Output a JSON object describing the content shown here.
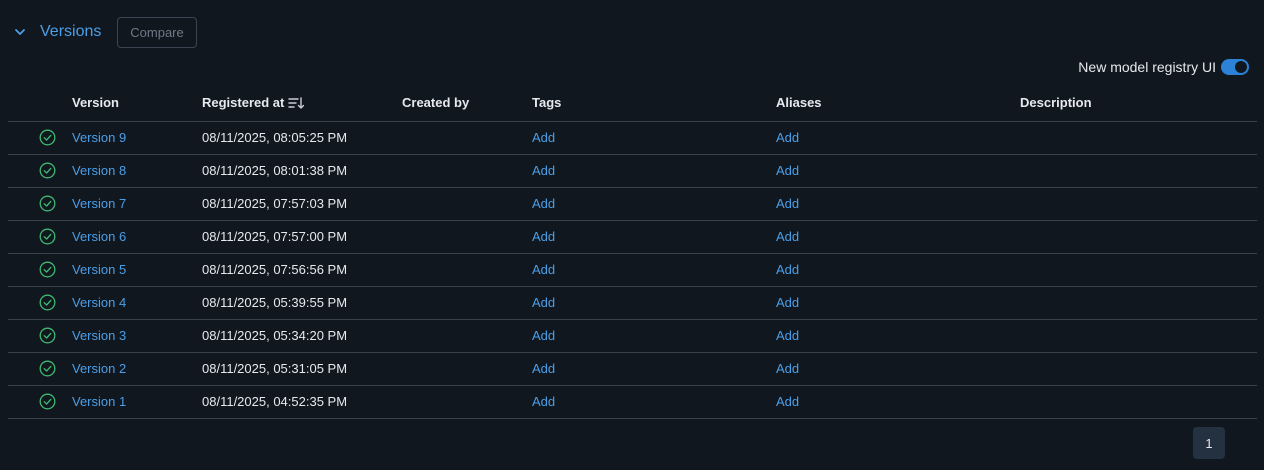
{
  "header": {
    "title": "Versions",
    "compare_label": "Compare"
  },
  "toggle": {
    "label": "New model registry UI",
    "enabled": true
  },
  "table": {
    "columns": {
      "version": "Version",
      "registered_at": "Registered at",
      "created_by": "Created by",
      "tags": "Tags",
      "aliases": "Aliases",
      "description": "Description"
    },
    "rows": [
      {
        "version": "Version 9",
        "registered_at": "08/11/2025, 08:05:25 PM",
        "created_by": "",
        "tags": "Add",
        "aliases": "Add",
        "description": ""
      },
      {
        "version": "Version 8",
        "registered_at": "08/11/2025, 08:01:38 PM",
        "created_by": "",
        "tags": "Add",
        "aliases": "Add",
        "description": ""
      },
      {
        "version": "Version 7",
        "registered_at": "08/11/2025, 07:57:03 PM",
        "created_by": "",
        "tags": "Add",
        "aliases": "Add",
        "description": ""
      },
      {
        "version": "Version 6",
        "registered_at": "08/11/2025, 07:57:00 PM",
        "created_by": "",
        "tags": "Add",
        "aliases": "Add",
        "description": ""
      },
      {
        "version": "Version 5",
        "registered_at": "08/11/2025, 07:56:56 PM",
        "created_by": "",
        "tags": "Add",
        "aliases": "Add",
        "description": ""
      },
      {
        "version": "Version 4",
        "registered_at": "08/11/2025, 05:39:55 PM",
        "created_by": "",
        "tags": "Add",
        "aliases": "Add",
        "description": ""
      },
      {
        "version": "Version 3",
        "registered_at": "08/11/2025, 05:34:20 PM",
        "created_by": "",
        "tags": "Add",
        "aliases": "Add",
        "description": ""
      },
      {
        "version": "Version 2",
        "registered_at": "08/11/2025, 05:31:05 PM",
        "created_by": "",
        "tags": "Add",
        "aliases": "Add",
        "description": ""
      },
      {
        "version": "Version 1",
        "registered_at": "08/11/2025, 04:52:35 PM",
        "created_by": "",
        "tags": "Add",
        "aliases": "Add",
        "description": ""
      }
    ]
  },
  "pagination": {
    "current_page": "1"
  },
  "icons": {
    "collapse": "chevron-down-icon",
    "sort": "sort-descending-icon",
    "status": "check-circle-icon"
  },
  "colors": {
    "background": "#11171f",
    "accent": "#4a9fe8",
    "success": "#3fb970",
    "border": "#3a424d"
  }
}
